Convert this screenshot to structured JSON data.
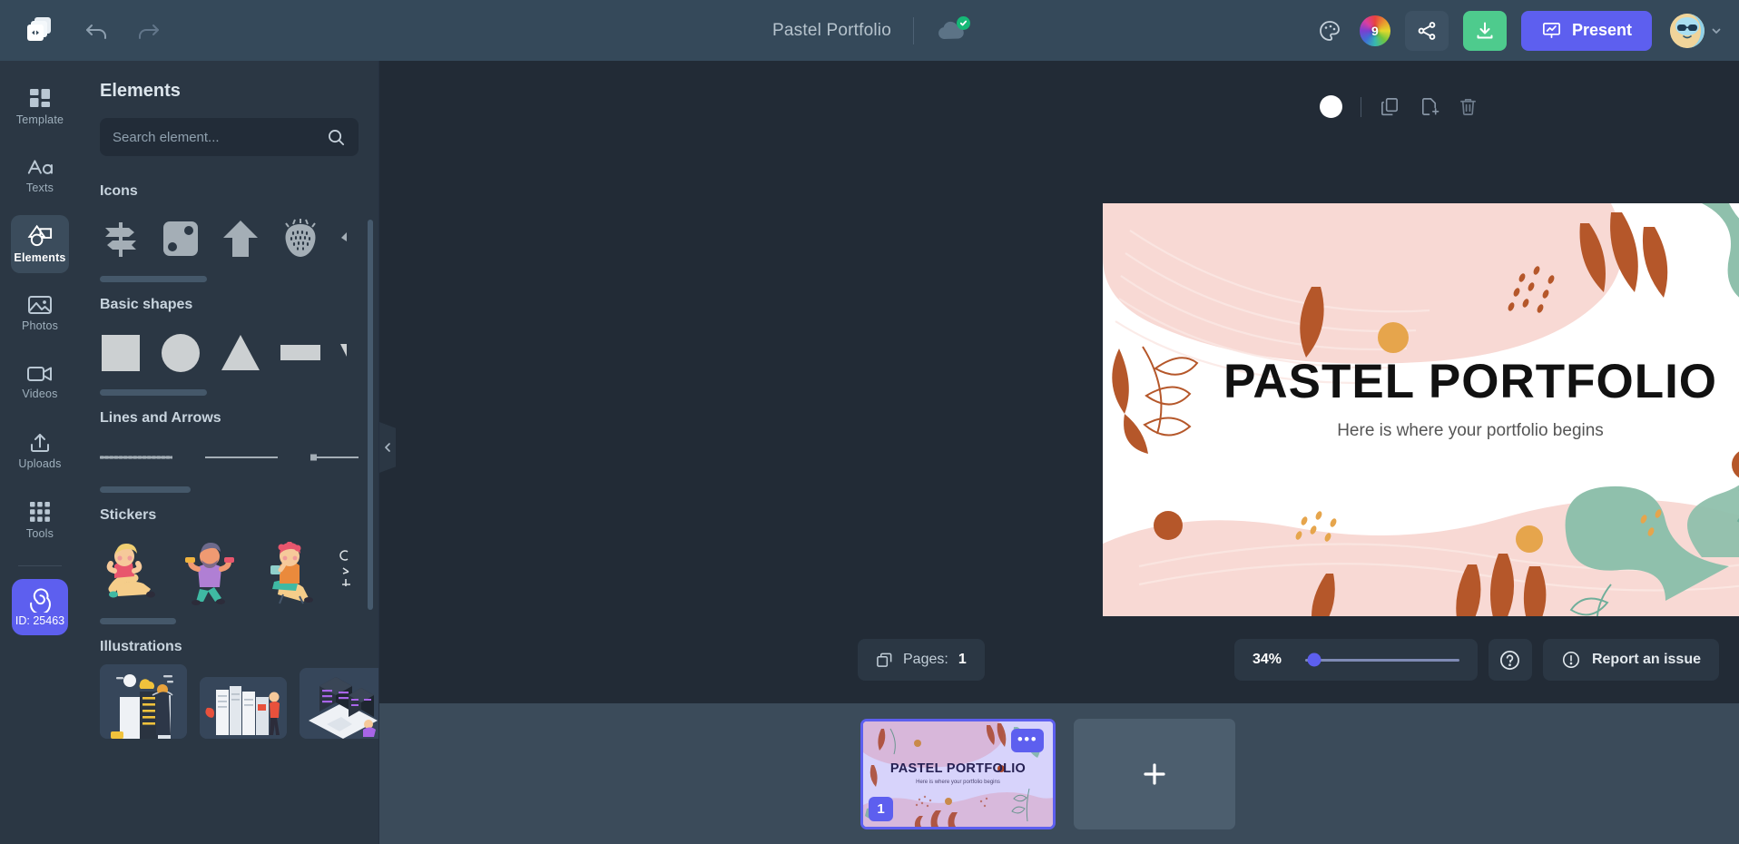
{
  "app": {
    "document_title": "Pastel Portfolio",
    "save_status_icon": "cloud-saved-icon"
  },
  "topbar": {
    "logo_icon": "app-logo-icon",
    "undo_icon": "undo-icon",
    "redo_icon": "redo-icon",
    "palette_icon": "palette-icon",
    "color_wheel_badge": "9",
    "share_icon": "share-icon",
    "download_icon": "download-icon",
    "present_label": "Present",
    "present_icon": "presentation-icon",
    "avatar_icon": "user-avatar",
    "account_caret_icon": "chevron-down-icon",
    "accent_purple": "#5d5fef",
    "accent_green": "#4ecb8d",
    "bar_bg": "#35495a"
  },
  "sidebar": {
    "items": [
      {
        "label": "Template",
        "icon": "template-icon",
        "active": false
      },
      {
        "label": "Texts",
        "icon": "text-icon",
        "active": false
      },
      {
        "label": "Elements",
        "icon": "elements-icon",
        "active": true
      },
      {
        "label": "Photos",
        "icon": "photos-icon",
        "active": false
      },
      {
        "label": "Videos",
        "icon": "videos-icon",
        "active": false
      },
      {
        "label": "Uploads",
        "icon": "uploads-icon",
        "active": false
      },
      {
        "label": "Tools",
        "icon": "tools-grid-icon",
        "active": false
      }
    ],
    "id_badge": {
      "label": "ID: 25463",
      "icon": "spiral-icon",
      "color": "#5d5fef"
    }
  },
  "panel": {
    "title": "Elements",
    "search": {
      "placeholder": "Search element...",
      "value": "",
      "icon": "search-icon"
    },
    "sections": [
      {
        "title": "Icons",
        "items": [
          "signpost-icon",
          "dice-icon",
          "arrow-up-icon",
          "strawberry-icon",
          "partial-icon"
        ]
      },
      {
        "title": "Basic shapes",
        "items": [
          "square-shape",
          "circle-shape",
          "triangle-shape",
          "rectangle-shape",
          "partial-shape"
        ]
      },
      {
        "title": "Lines and Arrows",
        "items": [
          "dotted-line",
          "solid-line",
          "square-endpoint-line"
        ]
      },
      {
        "title": "Stickers",
        "items": [
          "sticker-sitting-woman",
          "sticker-man-dumbbells",
          "sticker-woman-coffee",
          "partial-sticker"
        ]
      },
      {
        "title": "Illustrations",
        "items": [
          "illustration-server-cloud",
          "illustration-data-center",
          "illustration-isometric-servers"
        ]
      }
    ],
    "collapse_icon": "chevron-left-icon",
    "scrollbar": "panel-scrollbar"
  },
  "canvas": {
    "tools": {
      "background_color": "#ffffff",
      "duplicate_icon": "duplicate-page-icon",
      "add_page_icon": "add-page-icon",
      "delete_icon": "trash-icon"
    },
    "slide": {
      "title": "PASTEL PORTFOLIO",
      "subtitle": "Here is where your portfolio begins",
      "background": "#ffffff",
      "decor_colors": {
        "pink": "#f8d9d4",
        "terracotta": "#b5572a",
        "sage": "#8fc0ac",
        "amber": "#e6a54c"
      }
    }
  },
  "bottombar": {
    "pages_label": "Pages:",
    "pages_count": "1",
    "pages_icon": "pages-icon",
    "zoom_value": "34%",
    "zoom_percent": 34,
    "help_icon": "help-circle-icon",
    "report_label": "Report an issue",
    "report_icon": "alert-circle-icon"
  },
  "strip": {
    "pages": [
      {
        "number": "1",
        "title": "PASTEL PORTFOLIO",
        "subtitle": "Here is where your portfolio begins",
        "selected": true,
        "more_icon": "more-options-icon"
      }
    ],
    "add_page_icon": "plus-icon"
  }
}
